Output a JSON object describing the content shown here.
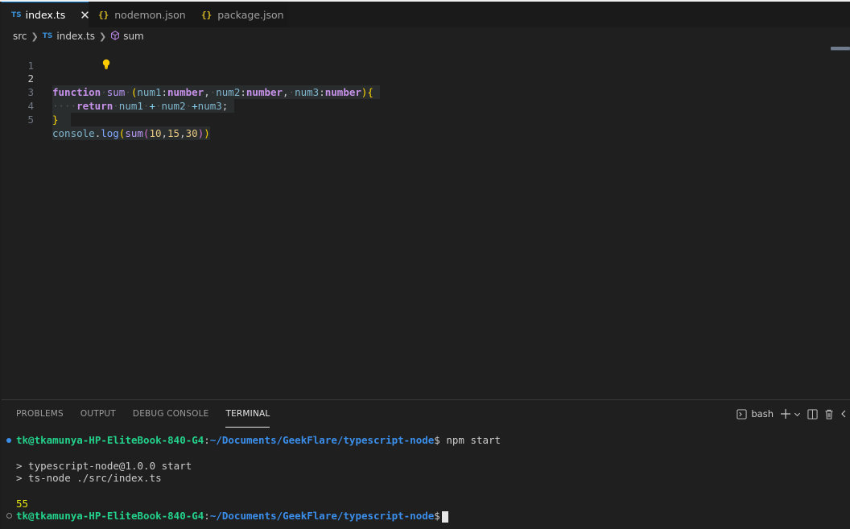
{
  "tabs": [
    {
      "badge": "TS",
      "label": "index.ts",
      "close": "✕"
    },
    {
      "badge": "{}",
      "label": "nodemon.json"
    },
    {
      "badge": "{}",
      "label": "package.json"
    }
  ],
  "breadcrumb": {
    "folder": "src",
    "file_badge": "TS",
    "file": "index.ts",
    "symbol": "sum"
  },
  "editor": {
    "line_numbers": [
      "1",
      "2",
      "3",
      "4",
      "5"
    ],
    "line2": {
      "kw": "function",
      "name": "sum",
      "p1": "num1",
      "t1": "number",
      "p2": "num2",
      "t2": "number",
      "p3": "num3",
      "t3": "number"
    },
    "line3": {
      "kw": "return",
      "a": "num1",
      "b": "num2",
      "c": "num3"
    },
    "line5": {
      "obj": "console",
      "method": "log",
      "fn": "sum",
      "args": [
        "10",
        "15",
        "30"
      ]
    }
  },
  "panel": {
    "tabs": [
      "PROBLEMS",
      "OUTPUT",
      "DEBUG CONSOLE",
      "TERMINAL"
    ],
    "shell": "bash"
  },
  "terminal": {
    "user": "tk@tkamunya-HP-EliteBook-840-G4",
    "path": "~/Documents/GeekFlare/typescript-node",
    "command": "npm start",
    "out1": "> typescript-node@1.0.0 start",
    "out2": "> ts-node ./src/index.ts",
    "result": "55"
  }
}
